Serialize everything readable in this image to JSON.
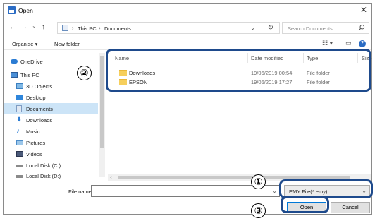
{
  "window": {
    "title": "Open"
  },
  "nav": {
    "back": "←",
    "forward": "→",
    "recent": "⌄",
    "up": "↑",
    "breadcrumb": [
      "This PC",
      "Documents"
    ],
    "search_placeholder": "Search Documents"
  },
  "toolbar": {
    "organise": "Organise ▾",
    "new_folder": "New folder"
  },
  "sidebar": {
    "items": [
      {
        "label": "OneDrive",
        "icon": "cloud-icon"
      },
      {
        "label": "This PC",
        "icon": "computer-icon"
      },
      {
        "label": "3D Objects",
        "icon": "cube-icon"
      },
      {
        "label": "Desktop",
        "icon": "desktop-icon"
      },
      {
        "label": "Documents",
        "icon": "documents-icon",
        "selected": true
      },
      {
        "label": "Downloads",
        "icon": "download-icon"
      },
      {
        "label": "Music",
        "icon": "music-icon"
      },
      {
        "label": "Pictures",
        "icon": "pictures-icon"
      },
      {
        "label": "Videos",
        "icon": "videos-icon"
      },
      {
        "label": "Local Disk (C:)",
        "icon": "drive-icon"
      },
      {
        "label": "Local Disk (D:)",
        "icon": "drive-icon"
      }
    ]
  },
  "filelist": {
    "columns": [
      "Name",
      "Date modified",
      "Type",
      "Size"
    ],
    "rows": [
      {
        "name": "Downloads",
        "date": "19/06/2019 00:54",
        "type": "File folder"
      },
      {
        "name": "EPSON",
        "date": "19/06/2019 17:27",
        "type": "File folder"
      }
    ]
  },
  "footer": {
    "file_name_label": "File name:",
    "file_name_value": "",
    "file_type": "EMY File(*.emy)",
    "open_label": "Open",
    "cancel_label": "Cancel"
  },
  "callouts": [
    "①",
    "②",
    "③"
  ],
  "colors": {
    "accent": "#0078d7",
    "callout": "#1e4a8c",
    "selection": "#cce4f7"
  }
}
